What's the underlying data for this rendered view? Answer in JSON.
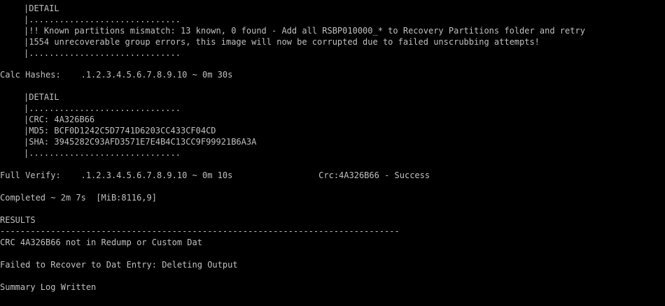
{
  "console": {
    "block1": {
      "detail": "|DETAIL",
      "dots": "|..............................",
      "mismatch": "|!! Known partitions mismatch: 13 known, 0 found - Add all RSBP010000_* to Recovery Partitions folder and retry",
      "errors": "|1554 unrecoverable group errors, this image will now be corrupted due to failed unscrubbing attempts!",
      "dots_end": "|.............................."
    },
    "calc_hashes": "Calc Hashes:    .1.2.3.4.5.6.7.8.9.10 ~ 0m 30s",
    "block2": {
      "detail": "|DETAIL",
      "dots": "|..............................",
      "crc": "|CRC: 4A326B66",
      "md5": "|MD5: BCF0D1242C5D7741D6203CC433CF04CD",
      "sha": "|SHA: 3945282C93AFD3571E7E4B4C13CC9F99921B6A3A",
      "dots_end": "|.............................."
    },
    "full_verify": "Full Verify:    .1.2.3.4.5.6.7.8.9.10 ~ 0m 10s                 Crc:4A326B66 - Success",
    "completed": "Completed ~ 2m 7s  [MiB:8116,9]",
    "results_header": "RESULTS",
    "separator": "-------------------------------------------------------------------------------",
    "crc_not_found": "CRC 4A326B66 not in Redump or Custom Dat",
    "failed_recover": "Failed to Recover to Dat Entry: Deleting Output",
    "summary": "Summary Log Written"
  }
}
